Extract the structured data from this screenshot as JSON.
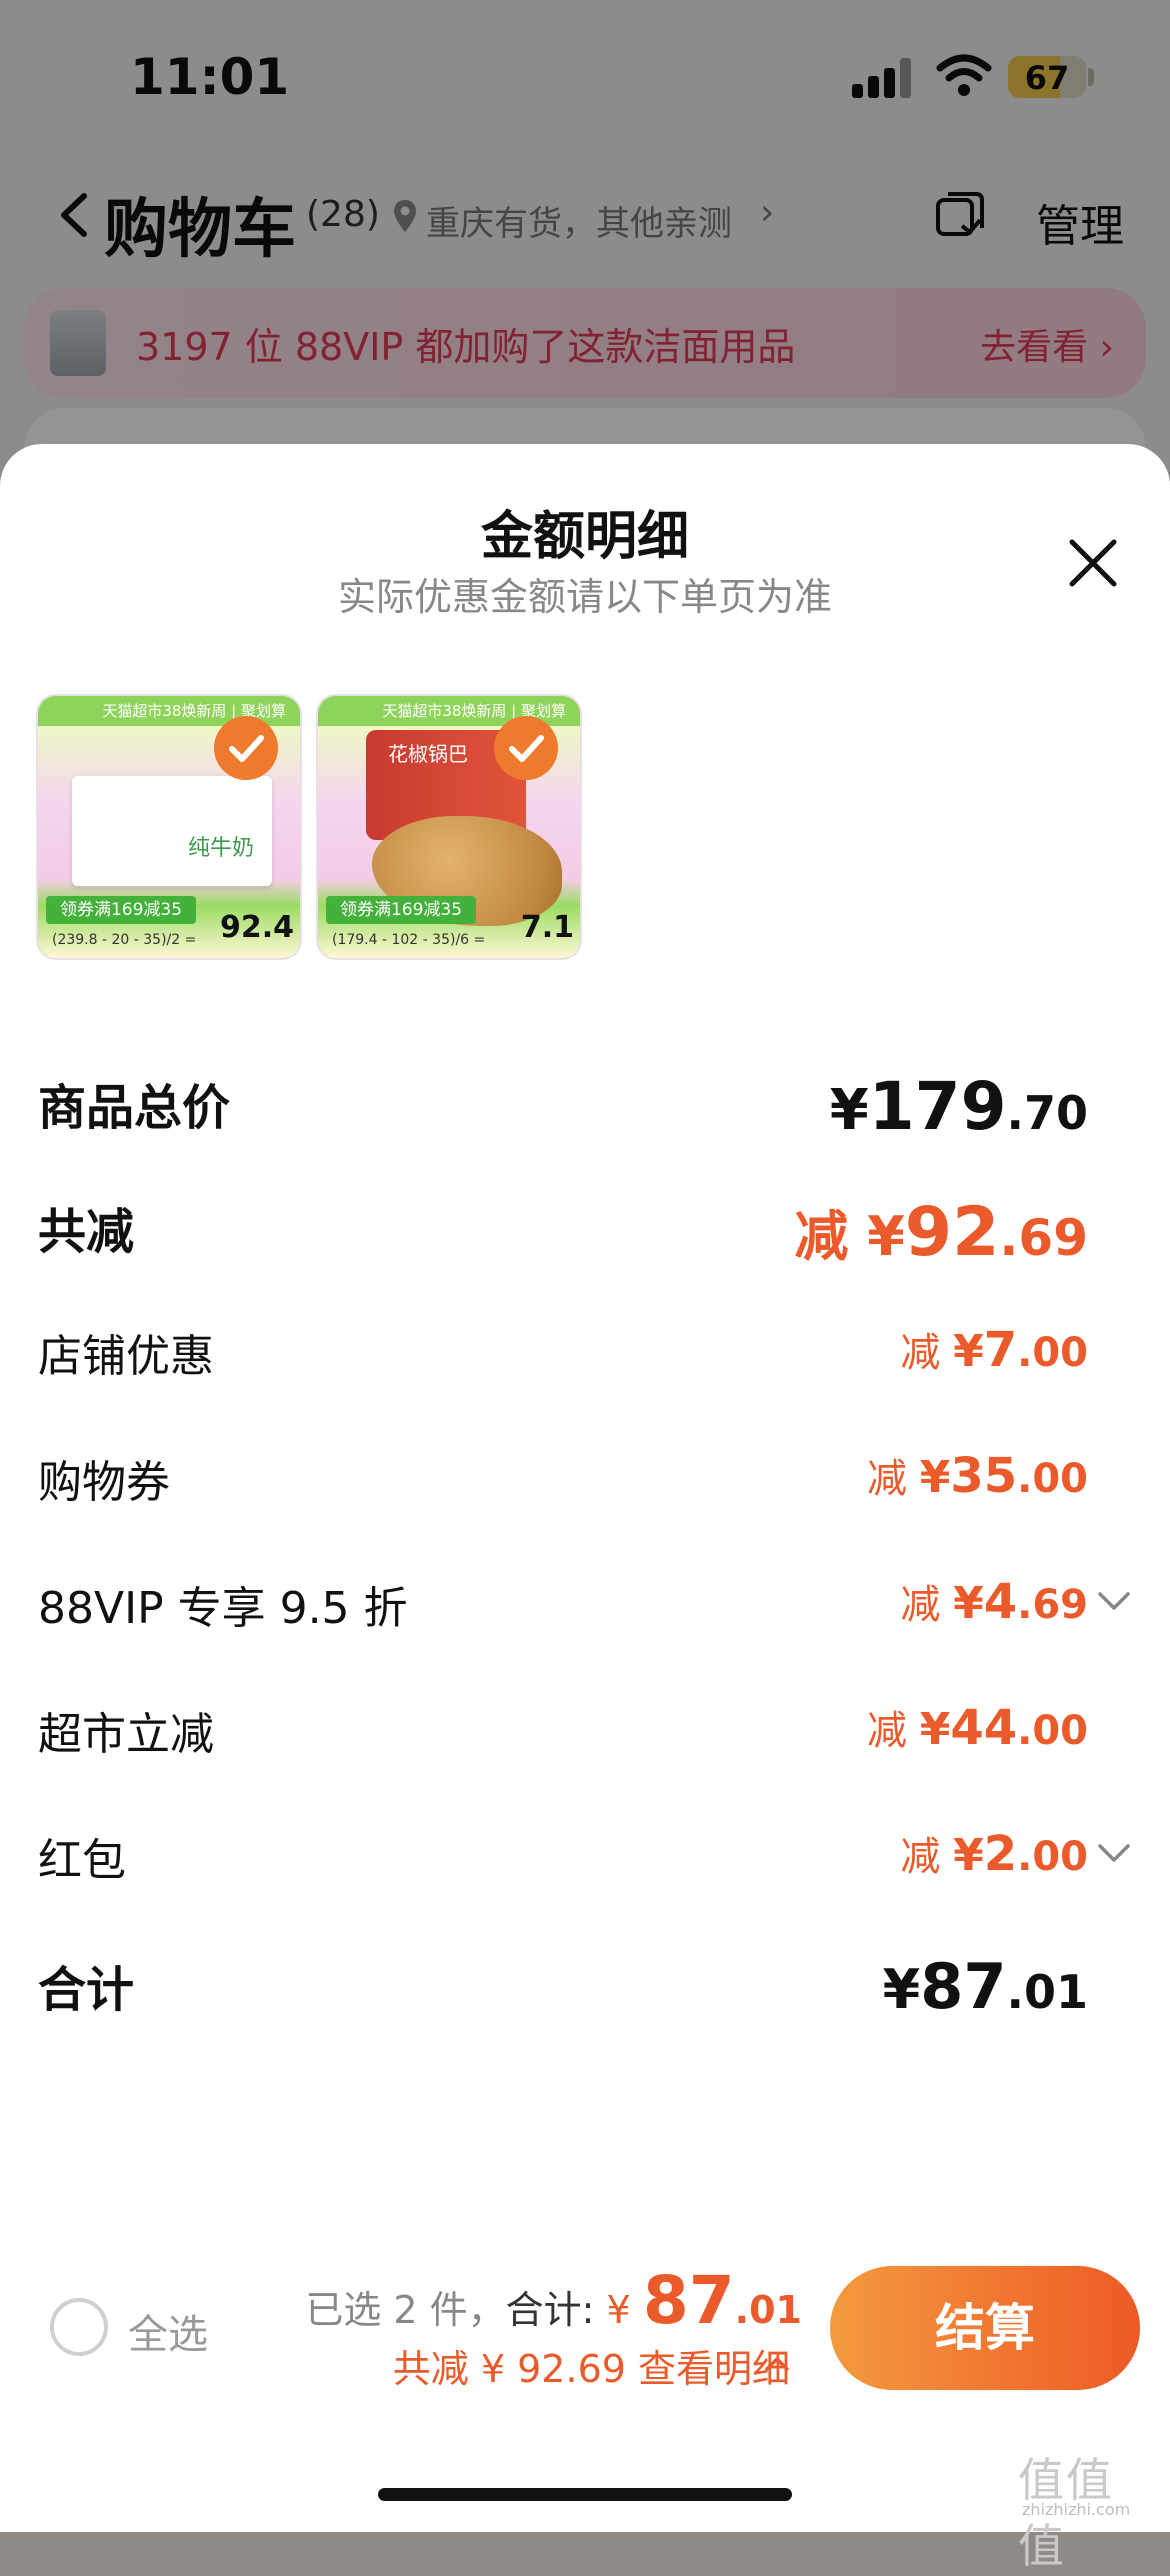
{
  "status_bar": {
    "time": "11:01",
    "battery": "67",
    "battery_level": 0.67
  },
  "nav": {
    "title": "购物车",
    "count": "(28)",
    "location": "重庆有货，其他亲测",
    "location_arrow": "›",
    "manage": "管理"
  },
  "promo": {
    "text": "3197 位 88VIP 都加购了这款洁面用品",
    "go": "去看看 ›"
  },
  "sheet": {
    "title": "金额明细",
    "subtitle": "实际优惠金额请以下单页为准"
  },
  "products": [
    {
      "banner": "天猫超市38焕新周 | 聚划算",
      "name": "纯牛奶",
      "coupon": "领券满169减35",
      "price": "92.4",
      "calc": "(239.8 - 20 - 35)/2 ="
    },
    {
      "banner": "天猫超市38焕新周 | 聚划算",
      "name": "花椒锅巴",
      "coupon": "领券满169减35",
      "price": "7.1",
      "calc": "(179.4 - 102 - 35)/6 ="
    }
  ],
  "rows": [
    {
      "label": "商品总价",
      "prefix": "",
      "currency": "¥",
      "int": "179",
      "dec": ".70"
    },
    {
      "label": "共减",
      "prefix": "减 ",
      "currency": "¥",
      "int": "92",
      "dec": ".69"
    },
    {
      "label": "店铺优惠",
      "prefix": "减 ",
      "currency": "¥",
      "int": "7",
      "dec": ".00"
    },
    {
      "label": "购物券",
      "prefix": "减 ",
      "currency": "¥",
      "int": "35",
      "dec": ".00"
    },
    {
      "label": "88VIP 专享 9.5 折",
      "prefix": "减 ",
      "currency": "¥",
      "int": "4",
      "dec": ".69"
    },
    {
      "label": "超市立减",
      "prefix": "减 ",
      "currency": "¥",
      "int": "44",
      "dec": ".00"
    },
    {
      "label": "红包",
      "prefix": "减 ",
      "currency": "¥",
      "int": "2",
      "dec": ".00"
    },
    {
      "label": "合计",
      "prefix": "",
      "currency": "¥",
      "int": "87",
      "dec": ".01"
    }
  ],
  "bottom": {
    "select_all": "全选",
    "selected": "已选 2 件，",
    "total_label": "合计: ",
    "currency": "¥ ",
    "total_int": "87",
    "total_dec": ".01",
    "detail": "共减 ¥ 92.69  查看明细",
    "checkout": "结算"
  },
  "watermark": {
    "glyphs": "值值值",
    "url": "zhizhizhi.com"
  },
  "colors": {
    "accent": "#ea5a2a",
    "checkout_start": "#f39a3e",
    "checkout_end": "#ee5a26",
    "promo_text": "#e23b58"
  }
}
